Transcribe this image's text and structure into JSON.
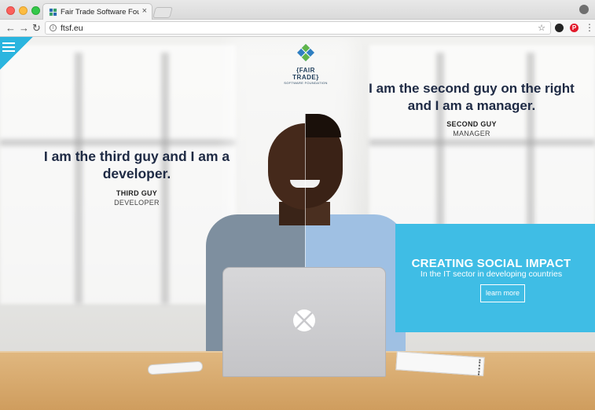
{
  "browser": {
    "tab_title": "Fair Trade Software Foundation",
    "tab_close": "×",
    "url": "ftsf.eu",
    "back": "←",
    "forward": "→",
    "reload": "↻",
    "info": "i",
    "star": "☆",
    "menu": "⋮",
    "ext_pinterest": "P"
  },
  "logo": {
    "text": "{FAIR TRADE}",
    "sub": "SOFTWARE FOUNDATION"
  },
  "left_person": {
    "headline_line1": "I am the third guy and I am a",
    "headline_line2": "developer.",
    "name": "THIRD GUY",
    "role": "DEVELOPER"
  },
  "right_person": {
    "headline_line1": "I am the second guy on the right",
    "headline_line2": "and I am a manager.",
    "name": "SECOND GUY",
    "role": "MANAGER"
  },
  "cta": {
    "title": "CREATING SOCIAL IMPACT",
    "subtitle": "In the IT sector in developing countries",
    "button": "learn more"
  },
  "colors": {
    "accent": "#3fbde5",
    "heading": "#1e2a44"
  }
}
